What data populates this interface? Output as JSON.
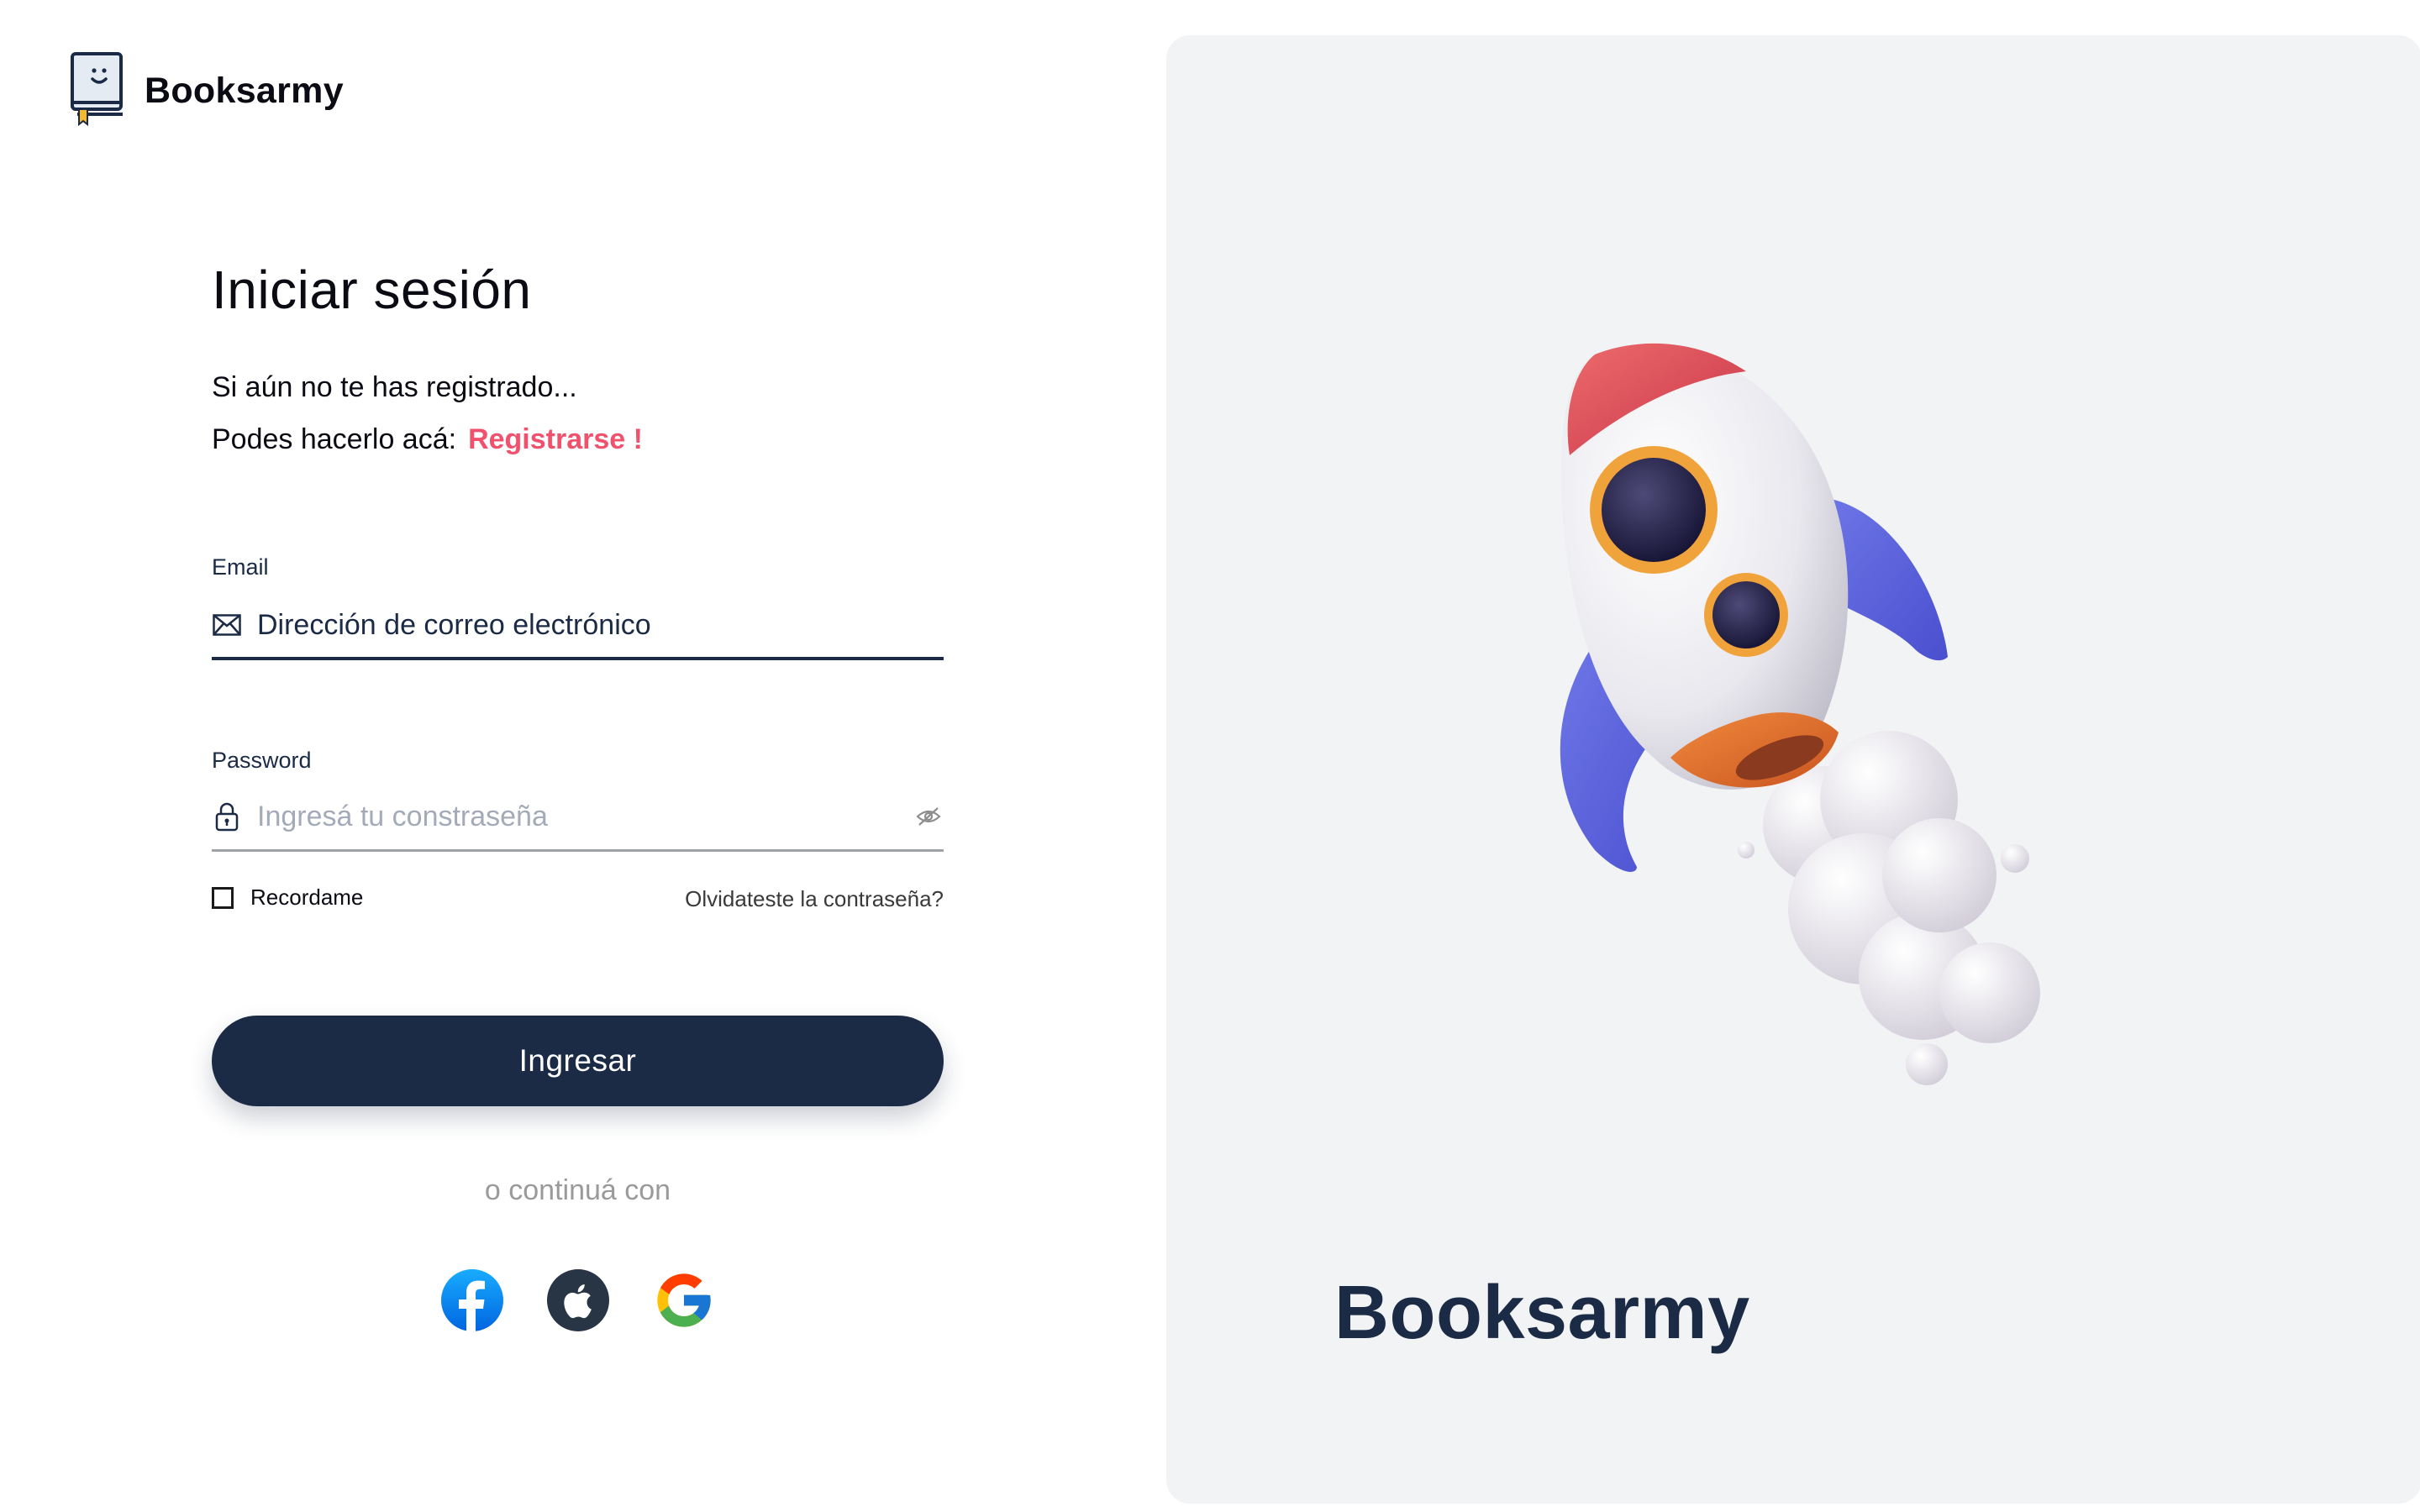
{
  "brand": {
    "name": "Booksarmy",
    "logo_icon": "book-smiley-icon"
  },
  "login": {
    "title": "Iniciar sesión",
    "subtitle_line1": "Si aún no te has registrado...",
    "subtitle_line2": "Podes hacerlo acá:",
    "register_link": "Registrarse !",
    "email": {
      "label": "Email",
      "icon": "mail-icon",
      "value": "Dirección de correo electrónico"
    },
    "password": {
      "label": "Password",
      "icon": "lock-icon",
      "placeholder": "Ingresá tu constraseña",
      "toggle_icon": "eye-off-icon"
    },
    "remember_label": "Recordame",
    "remember_checked": false,
    "forgot_link": "Olvidateste la contraseña?",
    "submit_label": "Ingresar",
    "continue_text": "o continuá con",
    "social": [
      {
        "name": "facebook",
        "icon": "facebook-icon"
      },
      {
        "name": "apple",
        "icon": "apple-icon"
      },
      {
        "name": "google",
        "icon": "google-icon"
      }
    ]
  },
  "hero": {
    "illustration": "rocket-illustration",
    "brand_name": "Booksarmy"
  },
  "colors": {
    "primary": "#1b2a45",
    "accent_link": "#f0516c",
    "panel_bg": "#f2f3f5"
  }
}
